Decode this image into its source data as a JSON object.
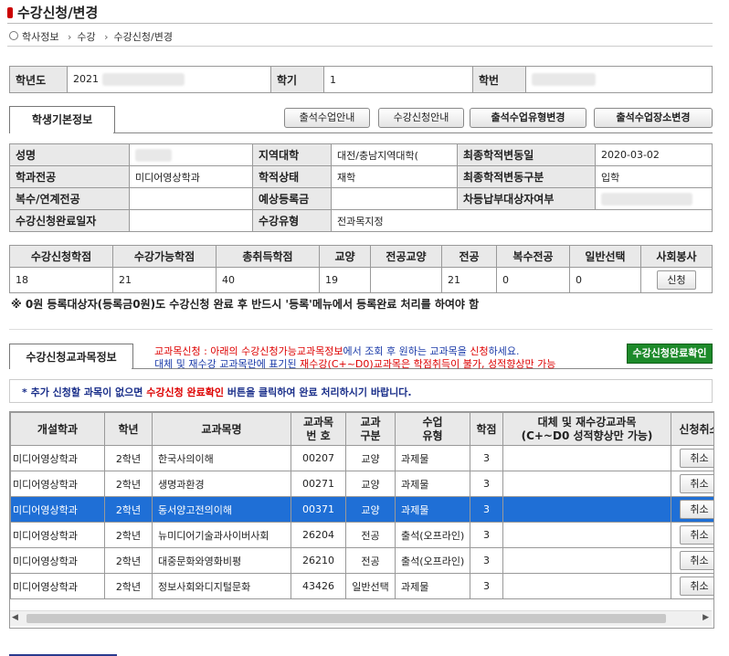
{
  "page": {
    "title": "수강신청/변경"
  },
  "breadcrumb": [
    "학사정보",
    "수강",
    "수강신청/변경"
  ],
  "header_row": {
    "year_label": "학년도",
    "year_value": "2021",
    "term_label": "학기",
    "term_value": "1",
    "id_label": "학번"
  },
  "student_tab": "학생기본정보",
  "top_buttons": [
    "출석수업안내",
    "수강신청안내",
    "출석수업유형변경",
    "출석수업장소변경"
  ],
  "info": {
    "name_label": "성명",
    "region_label": "지역대학",
    "region_value": "대전/충남지역대학(",
    "last_change_date_label": "최종학적변동일",
    "last_change_date_value": "2020-03-02",
    "major_label": "학과전공",
    "major_value": "미디어영상학과",
    "status_label": "학적상태",
    "status_value": "재학",
    "last_change_type_label": "최종학적변동구분",
    "last_change_type_value": "입학",
    "double_major_label": "복수/연계전공",
    "expected_fee_label": "예상등록금",
    "diff_payer_label": "차등납부대상자여부",
    "completion_date_label": "수강신청완료일자",
    "course_type_label": "수강유형",
    "course_type_value": "전과목지정"
  },
  "credits": {
    "headers": [
      "수강신청학점",
      "수강가능학점",
      "총취득학점",
      "교양",
      "전공교양",
      "전공",
      "복수전공",
      "일반선택",
      "사회봉사"
    ],
    "values": [
      "18",
      "21",
      "40",
      "19",
      "",
      "21",
      "0",
      "0"
    ],
    "apply_button": "신청"
  },
  "notice1": "※ 0원 등록대상자(등록금0원)도 수강신청 완료 후 반드시 '등록'메뉴에서 등록완료 처리를 하여야 함",
  "course_tab": "수강신청교과목정보",
  "red_note_line1_a": "교과목신청 : 아래의 ",
  "red_note_line1_b": "수강신청가능교과목정보",
  "red_note_line1_c": "에서 조회 후 원하는 교과목을 ",
  "red_note_line1_d": "신청",
  "red_note_line1_e": "하세요.",
  "blue_note_line2_a": "대체 및 재수강 교과목란에 표기된 ",
  "blue_note_line2_b": "재수강(C+~D0)교과목은 학점취득이 불가, 성적향상만 가능",
  "confirm_button": "수강신청완료확인",
  "notice2_a": "* 추가 신청할 과목이 없으면 ",
  "notice2_b": "수강신청 완료확인",
  "notice2_c": " 버튼을 클릭하여 완료 처리하시기 바랍니다.",
  "course_table": {
    "headers": [
      "개설학과",
      "학년",
      "교과목명",
      "교과목\n번 호",
      "교과\n구분",
      "수업\n유형",
      "학점",
      "대체 및 재수강교과목\n(C+~D0 성적향상만 가능)",
      "신청취소"
    ],
    "rows": [
      [
        "미디어영상학과",
        "2학년",
        "한국사의이해",
        "00207",
        "교양",
        "과제물",
        "3",
        "",
        "취소"
      ],
      [
        "미디어영상학과",
        "2학년",
        "생명과환경",
        "00271",
        "교양",
        "과제물",
        "3",
        "",
        "취소"
      ],
      [
        "미디어영상학과",
        "2학년",
        "동서양고전의이해",
        "00371",
        "교양",
        "과제물",
        "3",
        "",
        "취소"
      ],
      [
        "미디어영상학과",
        "2학년",
        "뉴미디어기술과사이버사회",
        "26204",
        "전공",
        "출석(오프라인)",
        "3",
        "",
        "취소"
      ],
      [
        "미디어영상학과",
        "2학년",
        "대중문화와영화비평",
        "26210",
        "전공",
        "출석(오프라인)",
        "3",
        "",
        "취소"
      ],
      [
        "미디어영상학과",
        "2학년",
        "정보사회와디지털문화",
        "43426",
        "일반선택",
        "과제물",
        "3",
        "",
        "취소"
      ]
    ],
    "selected_row": 2
  }
}
